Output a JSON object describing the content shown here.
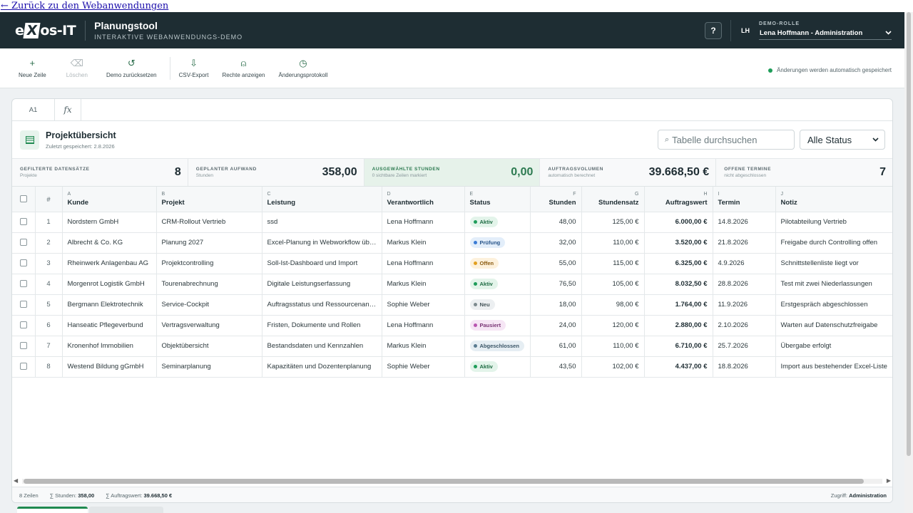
{
  "back_link": "← Zurück zu den Webanwendungen",
  "header": {
    "logo_left": "e",
    "logo_x": "X",
    "logo_right": "os-IT",
    "app_title": "Planungstool",
    "app_subtitle": "INTERAKTIVE WEBANWENDUNGS-DEMO",
    "help_label": "?",
    "initials": "LH",
    "role_label": "DEMO-ROLLE",
    "role_value": "Lena Hoffmann - Administration"
  },
  "toolbar": {
    "buttons": [
      {
        "label": "Neue Zeile",
        "icon": "plus-icon",
        "glyph": "+"
      },
      {
        "label": "Löschen",
        "icon": "delete-icon",
        "glyph": "⌫"
      },
      {
        "label": "Demo zurücksetzen",
        "icon": "reset-icon",
        "glyph": "↺"
      },
      {
        "label": "CSV-Export",
        "icon": "download-icon",
        "glyph": "⇩"
      },
      {
        "label": "Rechte anzeigen",
        "icon": "user-rights-icon",
        "glyph": "⍝"
      },
      {
        "label": "Änderungsprotokoll",
        "icon": "history-icon",
        "glyph": "◷"
      }
    ],
    "autosave": "Änderungen werden automatisch gespeichert"
  },
  "formula_bar": {
    "cell_ref": "A1",
    "fx": "fx"
  },
  "sheet": {
    "title": "Projektübersicht",
    "saved": "Zuletzt gespeichert: 2.8.2026",
    "search_placeholder": "Tabelle durchsuchen",
    "status_filter": "Alle Status"
  },
  "kpis": [
    {
      "label": "GEFILTERTE DATENSÄTZE",
      "sub": "Projekte",
      "value": "8"
    },
    {
      "label": "GEPLANTER AUFWAND",
      "sub": "Stunden",
      "value": "358,00"
    },
    {
      "label": "AUSGEWÄHLTE STUNDEN",
      "sub": "0 sichtbare Zeilen markiert",
      "value": "0,00"
    },
    {
      "label": "AUFTRAGSVOLUMEN",
      "sub": "automatisch berechnet",
      "value": "39.668,50 €"
    },
    {
      "label": "OFFENE TERMINE",
      "sub": "nicht abgeschlossen",
      "value": "7"
    }
  ],
  "columns": [
    {
      "letter": "",
      "name": "#"
    },
    {
      "letter": "A",
      "name": "Kunde"
    },
    {
      "letter": "B",
      "name": "Projekt"
    },
    {
      "letter": "C",
      "name": "Leistung"
    },
    {
      "letter": "D",
      "name": "Verantwortlich"
    },
    {
      "letter": "E",
      "name": "Status"
    },
    {
      "letter": "F",
      "name": "Stunden"
    },
    {
      "letter": "G",
      "name": "Stundensatz"
    },
    {
      "letter": "H",
      "name": "Auftragswert"
    },
    {
      "letter": "I",
      "name": "Termin"
    },
    {
      "letter": "J",
      "name": "Notiz"
    }
  ],
  "rows": [
    [
      "1",
      "Nordstern GmbH",
      "CRM-Rollout Vertrieb",
      "ssd",
      "Lena Hoffmann",
      "Aktiv",
      "48,00",
      "125,00 €",
      "6.000,00 €",
      "14.8.2026",
      "Pilotabteilung Vertrieb"
    ],
    [
      "2",
      "Albrecht & Co. KG",
      "Planung 2027",
      "Excel-Planung in Webworkflow überführen",
      "Markus Klein",
      "Prüfung",
      "32,00",
      "110,00 €",
      "3.520,00 €",
      "21.8.2026",
      "Freigabe durch Controlling offen"
    ],
    [
      "3",
      "Rheinwerk Anlagenbau AG",
      "Projektcontrolling",
      "Soll-Ist-Dashboard und Import",
      "Lena Hoffmann",
      "Offen",
      "55,00",
      "115,00 €",
      "6.325,00 €",
      "4.9.2026",
      "Schnittstellenliste liegt vor"
    ],
    [
      "4",
      "Morgenrot Logistik GmbH",
      "Tourenabrechnung",
      "Digitale Leistungserfassung",
      "Markus Klein",
      "Aktiv",
      "76,50",
      "105,00 €",
      "8.032,50 €",
      "28.8.2026",
      "Test mit zwei Niederlassungen"
    ],
    [
      "5",
      "Bergmann Elektrotechnik",
      "Service-Cockpit",
      "Auftragsstatus und Ressourcenansicht",
      "Sophie Weber",
      "Neu",
      "18,00",
      "98,00 €",
      "1.764,00 €",
      "11.9.2026",
      "Erstgespräch abgeschlossen"
    ],
    [
      "6",
      "Hanseatic Pflegeverbund",
      "Vertragsverwaltung",
      "Fristen, Dokumente und Rollen",
      "Lena Hoffmann",
      "Pausiert",
      "24,00",
      "120,00 €",
      "2.880,00 €",
      "2.10.2026",
      "Warten auf Datenschutzfreigabe"
    ],
    [
      "7",
      "Kronenhof Immobilien",
      "Objektübersicht",
      "Bestandsdaten und Kennzahlen",
      "Markus Klein",
      "Abgeschlossen",
      "61,00",
      "110,00 €",
      "6.710,00 €",
      "25.7.2026",
      "Übergabe erfolgt"
    ],
    [
      "8",
      "Westend Bildung gGmbH",
      "Seminarplanung",
      "Kapazitäten und Dozentenplanung",
      "Sophie Weber",
      "Aktiv",
      "43,50",
      "102,00 €",
      "4.437,00 €",
      "18.8.2026",
      "Import aus bestehender Excel-Liste"
    ]
  ],
  "status_colors": {
    "Aktiv": {
      "bg": "#e3f4ea",
      "fg": "#1d6b42",
      "dot": "#1f9d5a"
    },
    "Prüfung": {
      "bg": "#e3eefa",
      "fg": "#28558a",
      "dot": "#3a7bd5"
    },
    "Offen": {
      "bg": "#fdf1dc",
      "fg": "#8a5a10",
      "dot": "#e2a020"
    },
    "Neu": {
      "bg": "#eceff1",
      "fg": "#45555a",
      "dot": "#7d8a8e"
    },
    "Pausiert": {
      "bg": "#f6e6f5",
      "fg": "#7a3575",
      "dot": "#b855b0"
    },
    "Abgeschlossen": {
      "bg": "#e6eef3",
      "fg": "#3a5566",
      "dot": "#5a7b90"
    }
  },
  "statusbar": {
    "rows": "8 Zeilen",
    "hours_label": "∑ Stunden:",
    "hours_value": "358,00",
    "value_label": "∑ Auftragswert:",
    "value_value": "39.668,50 €",
    "access_label": "Zugriff:",
    "access_value": "Administration"
  }
}
